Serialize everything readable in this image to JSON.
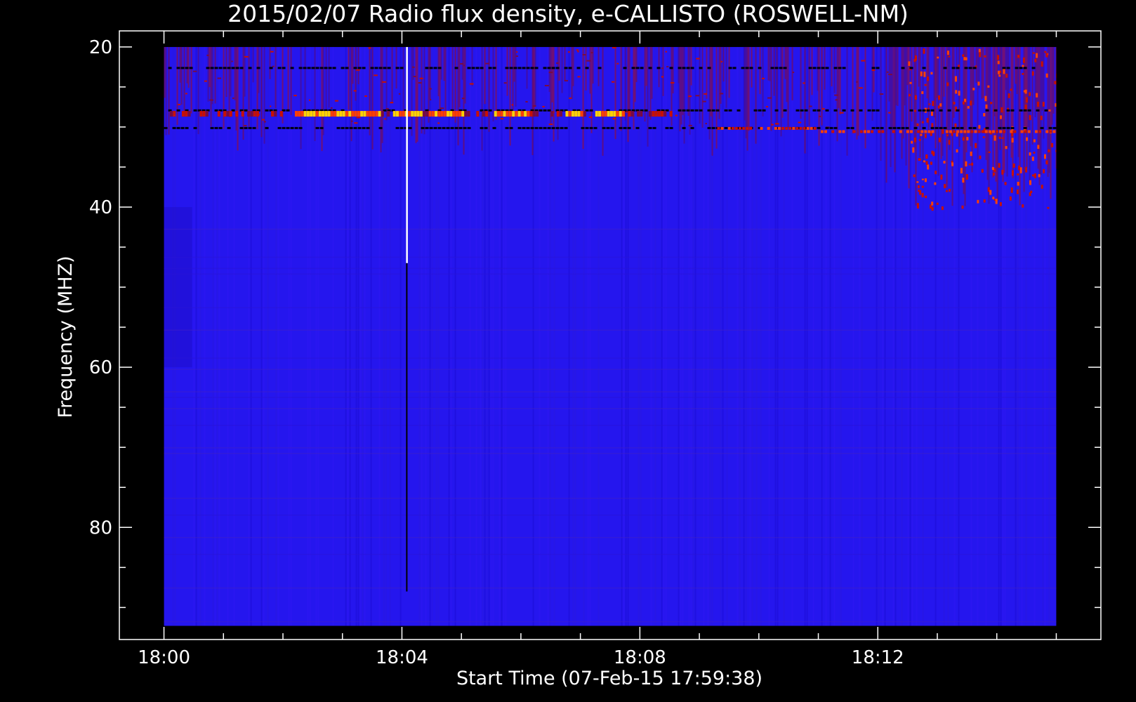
{
  "chart_data": {
    "type": "heatmap",
    "title": "2015/02/07  Radio flux density, e-CALLISTO (ROSWELL-NM)",
    "xlabel": "Start Time (07-Feb-15 17:59:38)",
    "ylabel": "Frequency (MHZ)",
    "x_tick_labels": [
      "18:00",
      "18:04",
      "18:08",
      "18:12"
    ],
    "x_tick_minutes": [
      0,
      4,
      8,
      12
    ],
    "x_minor_tick_minutes": [
      1,
      2,
      3,
      5,
      6,
      7,
      9,
      10,
      11,
      13,
      14,
      15
    ],
    "y_tick_labels": [
      "20",
      "40",
      "60",
      "80"
    ],
    "y_tick_values": [
      20,
      40,
      60,
      80
    ],
    "y_minor_tick_values": [
      25,
      30,
      35,
      45,
      50,
      55,
      65,
      70,
      75,
      85,
      90
    ],
    "y_inverted": true,
    "x_range_minutes": [
      -0.75,
      15.75
    ],
    "y_range_mhz": [
      18,
      94
    ],
    "data_extent": {
      "time_start_minutes": 0,
      "time_end_minutes": 15,
      "freq_top_mhz": 20,
      "freq_bottom_mhz": 92.3
    },
    "colormap": [
      "#000000",
      "#1a00c8",
      "#2a10f0",
      "#7a0a40",
      "#c81000",
      "#ff4000",
      "#ffd200",
      "#ffffff"
    ],
    "background_color": "#2516ee",
    "features": {
      "interference_band_mhz": [
        20,
        40
      ],
      "strong_line_mhz": 28.5,
      "secondary_line_mhz": 31,
      "spike_time_minutes": 4.07
    }
  }
}
